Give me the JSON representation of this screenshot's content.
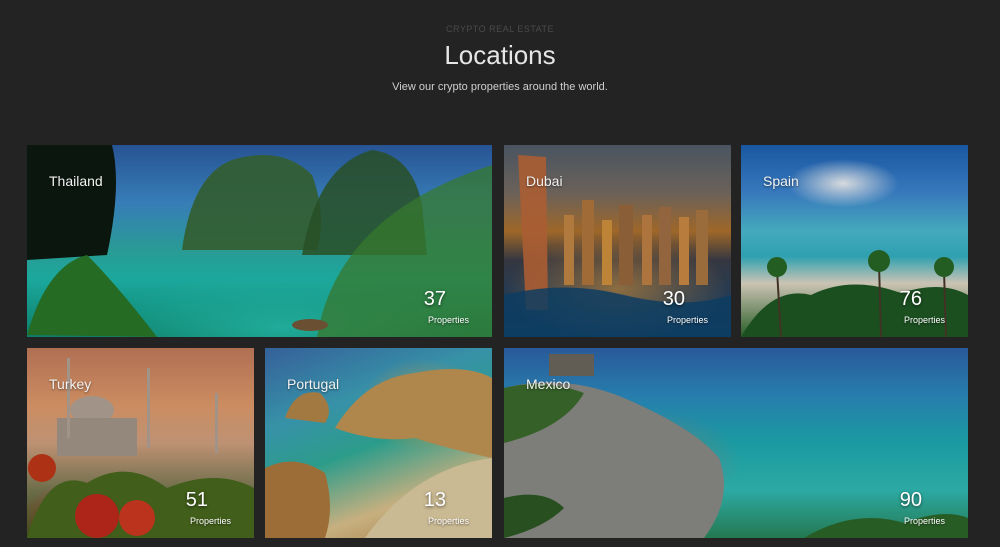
{
  "header": {
    "eyebrow": "CRYPTO REAL ESTATE",
    "title": "Locations",
    "subtitle": "View our crypto properties around the world."
  },
  "locations": [
    {
      "name": "Thailand",
      "count": "37",
      "label": "Properties"
    },
    {
      "name": "Dubai",
      "count": "30",
      "label": "Properties"
    },
    {
      "name": "Spain",
      "count": "76",
      "label": "Properties"
    },
    {
      "name": "Turkey",
      "count": "51",
      "label": "Properties"
    },
    {
      "name": "Portugal",
      "count": "13",
      "label": "Properties"
    },
    {
      "name": "Mexico",
      "count": "90",
      "label": "Properties"
    }
  ],
  "colors": {
    "background": "#232323",
    "title": "#e6e6e6",
    "eyebrow": "#4a4a4a"
  }
}
